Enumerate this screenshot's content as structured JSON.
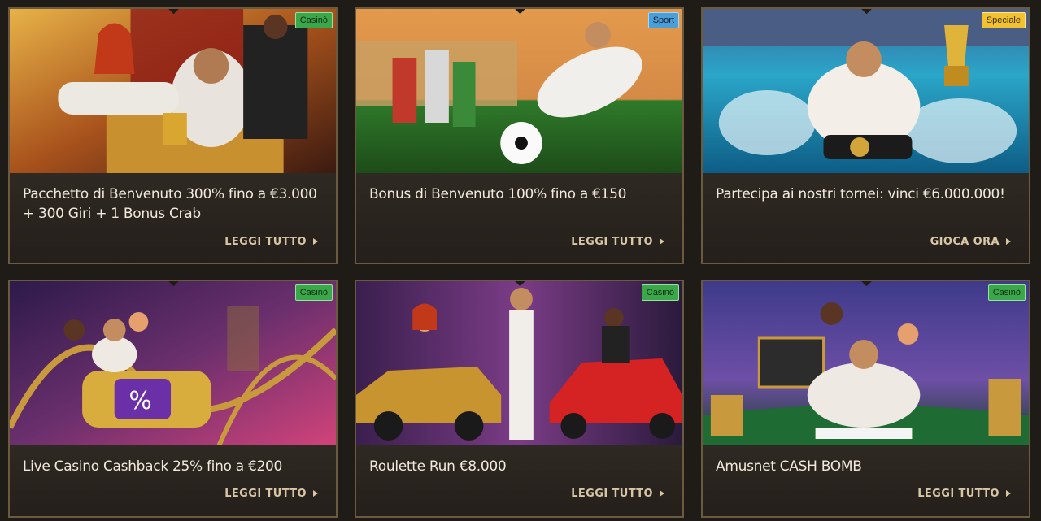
{
  "cards": [
    {
      "badge": "Casinò",
      "badge_type": "casino",
      "title_line1": "Pacchetto di Benvenuto 300% fino a €3.000",
      "title_line2": "+ 300 Giri + 1 Bonus Crab",
      "cta": "LEGGI TUTTO",
      "scene": "throne-pharaoh"
    },
    {
      "badge": "Sport",
      "badge_type": "sport",
      "title_line1": "Bonus di Benvenuto 100% fino a €150",
      "title_line2": "",
      "cta": "LEGGI TUTTO",
      "scene": "football-pharaoh"
    },
    {
      "badge": "Speciale",
      "badge_type": "special",
      "title_line1": "Partecipa ai nostri tornei: vinci €6.000.000!",
      "title_line2": "",
      "cta": "GIOCA ORA",
      "scene": "jetski-trophy"
    },
    {
      "badge": "Casinò",
      "badge_type": "casino",
      "title_line1": "Live Casino Cashback 25% fino a €200",
      "title_line2": "",
      "cta": "LEGGI TUTTO",
      "scene": "rollercoaster-cashback"
    },
    {
      "badge": "Casinò",
      "badge_type": "casino",
      "title_line1": "Roulette Run €8.000",
      "title_line2": "",
      "cta": "LEGGI TUTTO",
      "scene": "cars-money"
    },
    {
      "badge": "Casinò",
      "badge_type": "casino",
      "title_line1": "Amusnet CASH BOMB",
      "title_line2": "",
      "cta": "LEGGI TUTTO",
      "scene": "poker-table"
    }
  ],
  "colors": {
    "page_bg": "#1f1b17",
    "card_border": "#6b5a40",
    "title_text": "#f1e9dc",
    "cta_text": "#d9c6a7",
    "badge_casino": "#3aa84a",
    "badge_sport": "#4b9fd9",
    "badge_special": "#f2c230"
  }
}
